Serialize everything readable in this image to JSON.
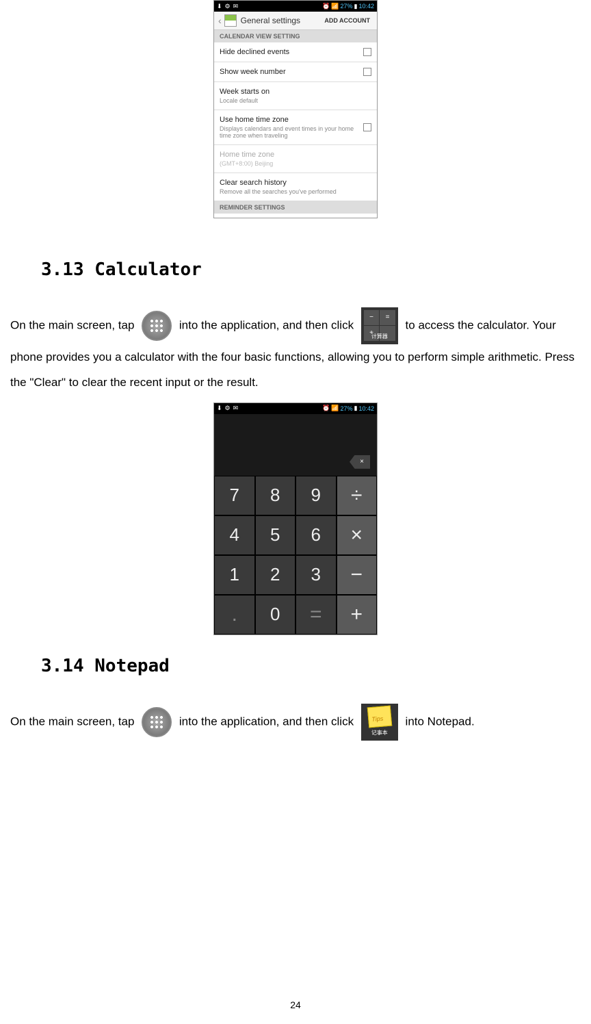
{
  "status_bar": {
    "battery": "27%",
    "time": "10:42"
  },
  "settings": {
    "header_title": "General settings",
    "add_account": "ADD ACCOUNT",
    "section1": "CALENDAR VIEW SETTING",
    "hide_declined": "Hide declined events",
    "show_week": "Show week number",
    "week_starts": "Week starts on",
    "week_starts_sub": "Locale default",
    "home_tz": "Use home time zone",
    "home_tz_sub": "Displays calendars and event times in your home time zone when traveling",
    "home_tz_disabled": "Home time zone",
    "home_tz_disabled_sub": "(GMT+8:00) Beijing",
    "clear_history": "Clear search history",
    "clear_history_sub": "Remove all the searches you've performed",
    "section2": "REMINDER SETTINGS"
  },
  "headings": {
    "calculator": "3.13 Calculator",
    "notepad": "3.14 Notepad"
  },
  "text": {
    "calc_p1_a": "On the main screen, tap",
    "calc_p1_b": "into the application, and then click",
    "calc_p1_c": "to access the",
    "calc_p2": "calculator. Your phone provides you a calculator with the four basic functions, allowing you to perform simple arithmetic. Press the \"Clear\" to clear the recent input or the result.",
    "notepad_p1_a": "On the main screen, tap",
    "notepad_p1_b": "into the application, and then click",
    "notepad_p1_c": "into Notepad."
  },
  "calc_icon": {
    "minus": "−",
    "equals": "=",
    "plus": "+",
    "label": "计算器"
  },
  "notepad_icon": {
    "label": "记事本"
  },
  "calculator": {
    "backspace": "×",
    "buttons": [
      "7",
      "8",
      "9",
      "÷",
      "4",
      "5",
      "6",
      "×",
      "1",
      "2",
      "3",
      "−",
      ".",
      "0",
      "=",
      "+"
    ]
  },
  "page_number": "24"
}
